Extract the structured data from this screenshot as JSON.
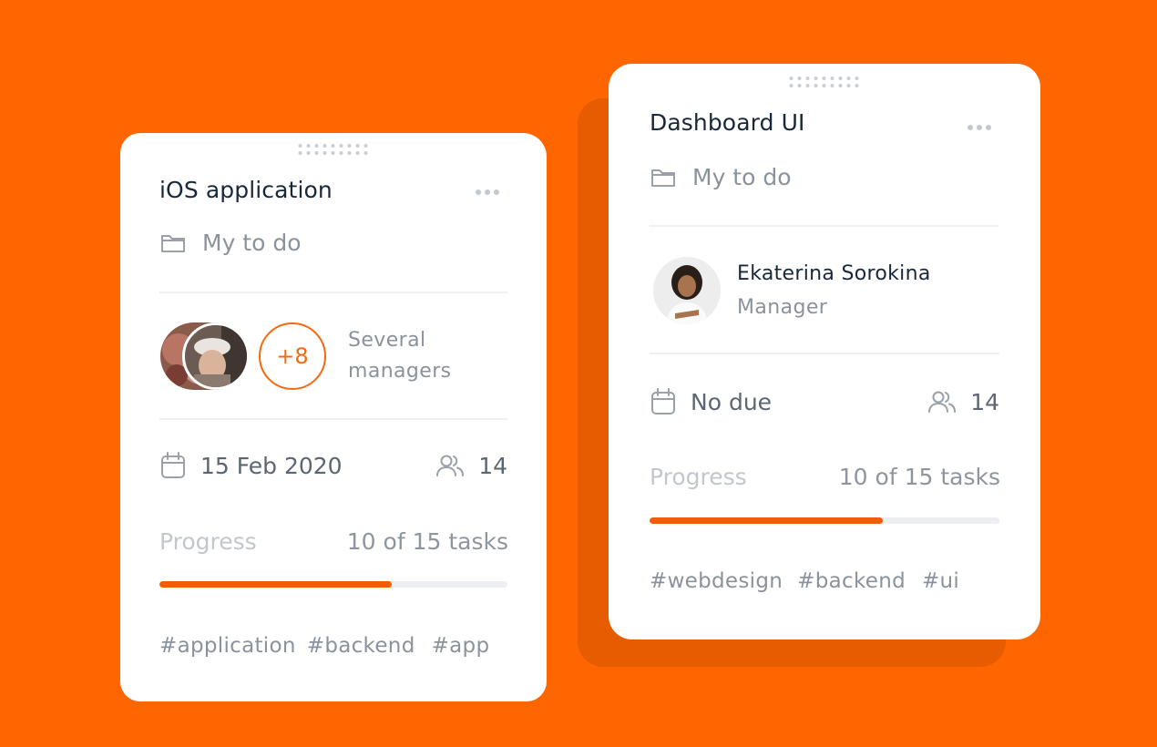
{
  "colors": {
    "background": "#ff6600",
    "accent": "#f25c05",
    "card": "#ffffff"
  },
  "cards": [
    {
      "title": "iOS application",
      "folder": "My to do",
      "assignee": {
        "extra_count": "+8",
        "label_line1": "Several",
        "label_line2": "managers"
      },
      "due": "15 Feb 2020",
      "members": "14",
      "progress": {
        "label": "Progress",
        "value": "10 of 15 tasks",
        "fraction": 0.6667
      },
      "tags": [
        "#application",
        "#backend",
        "#app"
      ]
    },
    {
      "title": "Dashboard UI",
      "folder": "My to do",
      "assignee": {
        "name": "Ekaterina Sorokina",
        "role": "Manager"
      },
      "due": "No due",
      "members": "14",
      "progress": {
        "label": "Progress",
        "value": "10 of 15 tasks",
        "fraction": 0.6667
      },
      "tags": [
        "#webdesign",
        "#backend",
        "#ui"
      ]
    }
  ],
  "icons": {
    "handle": "drag-handle-icon",
    "more": "more-horizontal-icon",
    "folder": "folder-icon",
    "calendar": "calendar-icon",
    "users": "users-icon"
  }
}
